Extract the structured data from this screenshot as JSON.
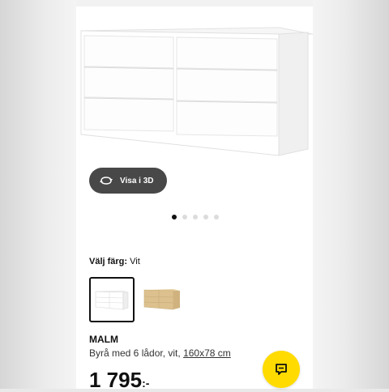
{
  "product": {
    "view_3d_label": "Visa i 3D",
    "carousel": {
      "count": 5,
      "active": 0
    },
    "color": {
      "label": "Välj färg:",
      "value": "Vit"
    },
    "swatches": [
      {
        "name": "white-swatch",
        "selected": true
      },
      {
        "name": "birch-swatch",
        "selected": false
      }
    ],
    "name": "MALM",
    "description_prefix": "Byrå med 6 lådor, vit, ",
    "size_link": "160x78 cm",
    "price": "1 795",
    "price_suffix": ":-"
  },
  "colors": {
    "chat_button": "#ffdb00",
    "button_dark": "#484848",
    "furniture_white": "#ffffff",
    "furniture_birch": "#dcc18e"
  },
  "icons": {
    "rotate": "rotate-3d-icon",
    "chat": "chat-icon"
  }
}
